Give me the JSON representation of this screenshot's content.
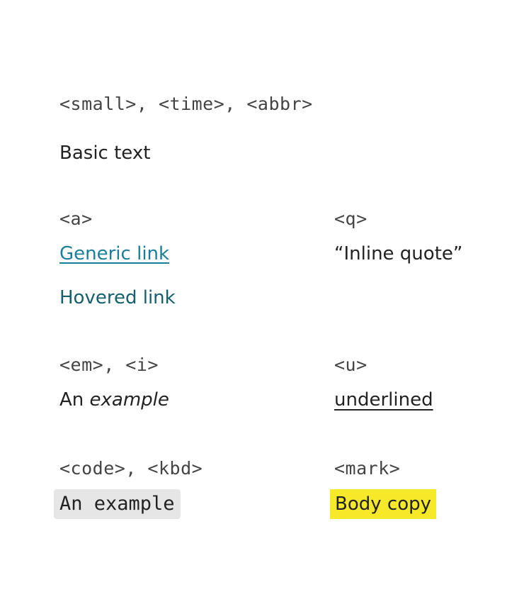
{
  "section_small": {
    "tag_label": "<small>, <time>, <abbr>",
    "text": "Basic text"
  },
  "section_a": {
    "tag_label": "<a>",
    "generic_link": "Generic link",
    "hovered_link": "Hovered link"
  },
  "section_q": {
    "tag_label": "<q>",
    "text": "“Inline quote”"
  },
  "section_em": {
    "tag_label": "<em>, <i>",
    "text_plain": "An",
    "text_emphasis": "example"
  },
  "section_u": {
    "tag_label": "<u>",
    "text": "underlined"
  },
  "section_code": {
    "tag_label": "<code>, <kbd>",
    "text": "An example"
  },
  "section_mark": {
    "tag_label": "<mark>",
    "text": "Body copy"
  },
  "colors": {
    "link": "#1a7f9a",
    "link_hover": "#15606f",
    "code_background": "#e6e6e6",
    "mark_background": "#f5e92a"
  }
}
